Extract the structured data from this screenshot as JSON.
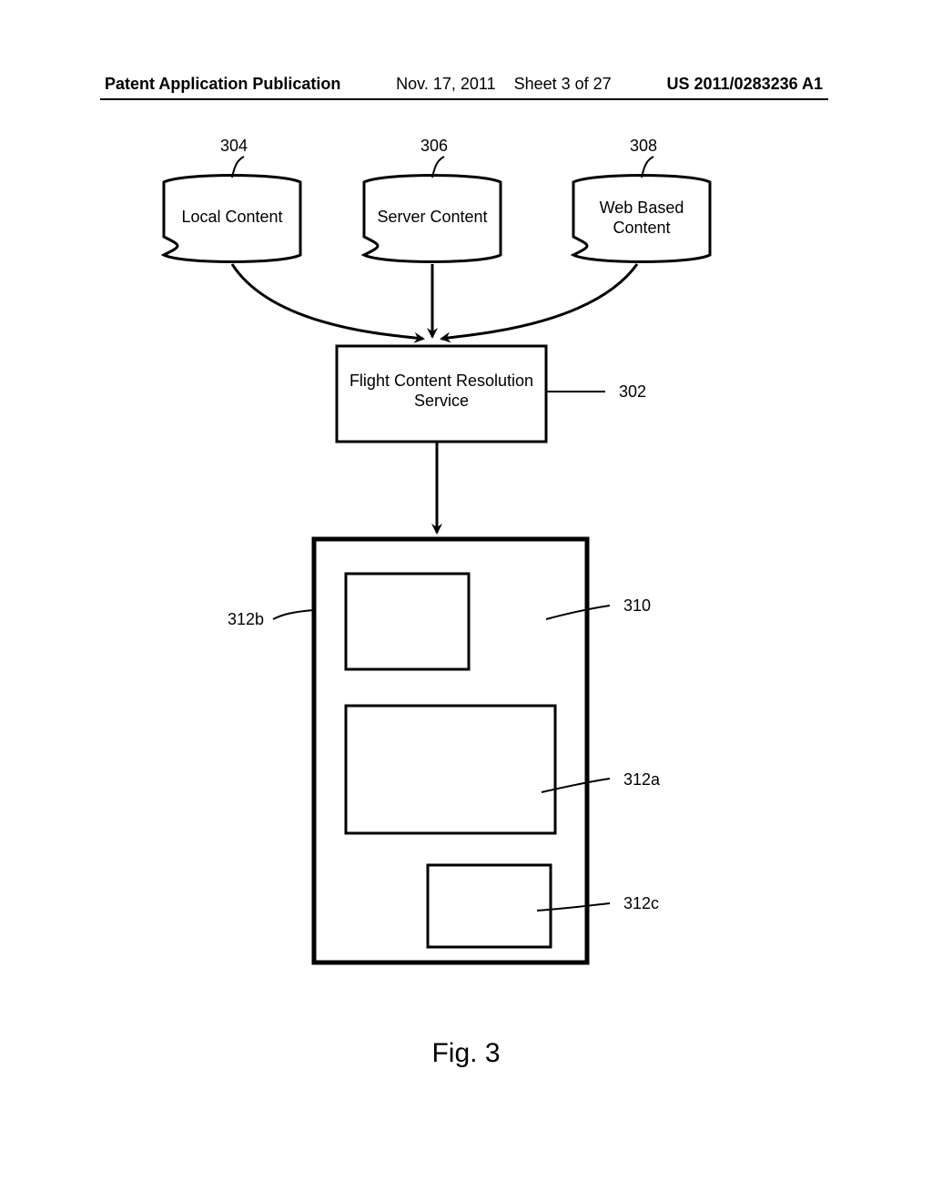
{
  "header": {
    "left": "Patent Application Publication",
    "date": "Nov. 17, 2011",
    "sheet": "Sheet 3 of 27",
    "pubno": "US 2011/0283236 A1"
  },
  "figure": {
    "caption": "Fig. 3",
    "sources": {
      "local": {
        "label": "Local Content",
        "ref": "304"
      },
      "server": {
        "label": "Server Content",
        "ref": "306"
      },
      "web": {
        "label_line1": "Web Based",
        "label_line2": "Content",
        "ref": "308"
      }
    },
    "service": {
      "label_line1": "Flight Content Resolution",
      "label_line2": "Service",
      "ref": "302"
    },
    "display": {
      "ref": "310",
      "regions": {
        "b": "312b",
        "a": "312a",
        "c": "312c"
      }
    }
  }
}
